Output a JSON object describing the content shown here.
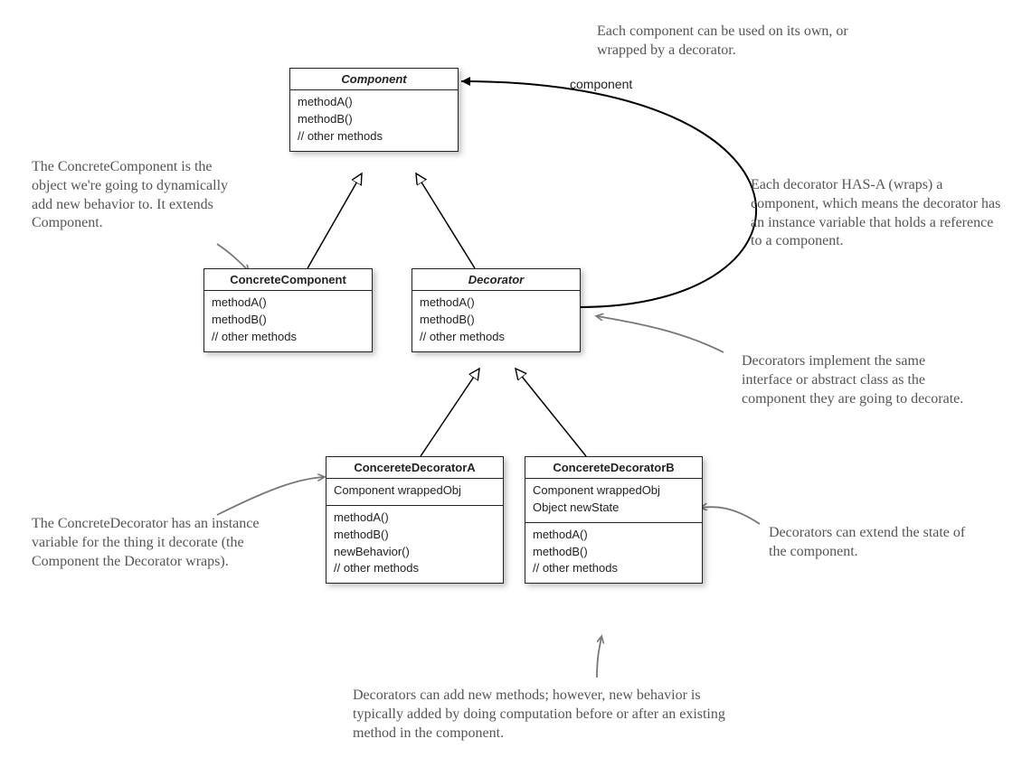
{
  "classes": {
    "component": {
      "title": "Component",
      "methods": [
        "methodA()",
        "methodB()",
        "// other methods"
      ]
    },
    "concreteComponent": {
      "title": "ConcreteComponent",
      "methods": [
        "methodA()",
        "methodB()",
        "// other methods"
      ]
    },
    "decorator": {
      "title": "Decorator",
      "methods": [
        "methodA()",
        "methodB()",
        "// other methods"
      ]
    },
    "concreteDecoratorA": {
      "title": "ConcereteDecoratorA",
      "fields": [
        "Component wrappedObj"
      ],
      "methods": [
        "methodA()",
        "methodB()",
        "newBehavior()",
        "// other methods"
      ]
    },
    "concreteDecoratorB": {
      "title": "ConcereteDecoratorB",
      "fields": [
        "Component wrappedObj",
        "Object newState"
      ],
      "methods": [
        "methodA()",
        "methodB()",
        "// other methods"
      ]
    }
  },
  "labels": {
    "componentRole": "component"
  },
  "notes": {
    "topRight": "Each component can be used on its own, or wrapped by a decorator.",
    "hasA": "Each decorator HAS-A (wraps) a component, which means the decorator has an instance variable that holds a reference to a component.",
    "sameInterface": "Decorators implement the same interface or abstract class as the component they are going to decorate.",
    "extendState": "Decorators can extend the state of the component.",
    "addMethods": "Decorators can add new methods; however, new behavior is typically added by doing computation before or after an existing method in the component.",
    "concreteDecorator": "The ConcreteDecorator has an instance variable for the thing it decorate (the Component the Decorator wraps).",
    "concreteComponent": "The ConcreteComponent is the object we're going to dynamically add new behavior to. It extends Component."
  }
}
